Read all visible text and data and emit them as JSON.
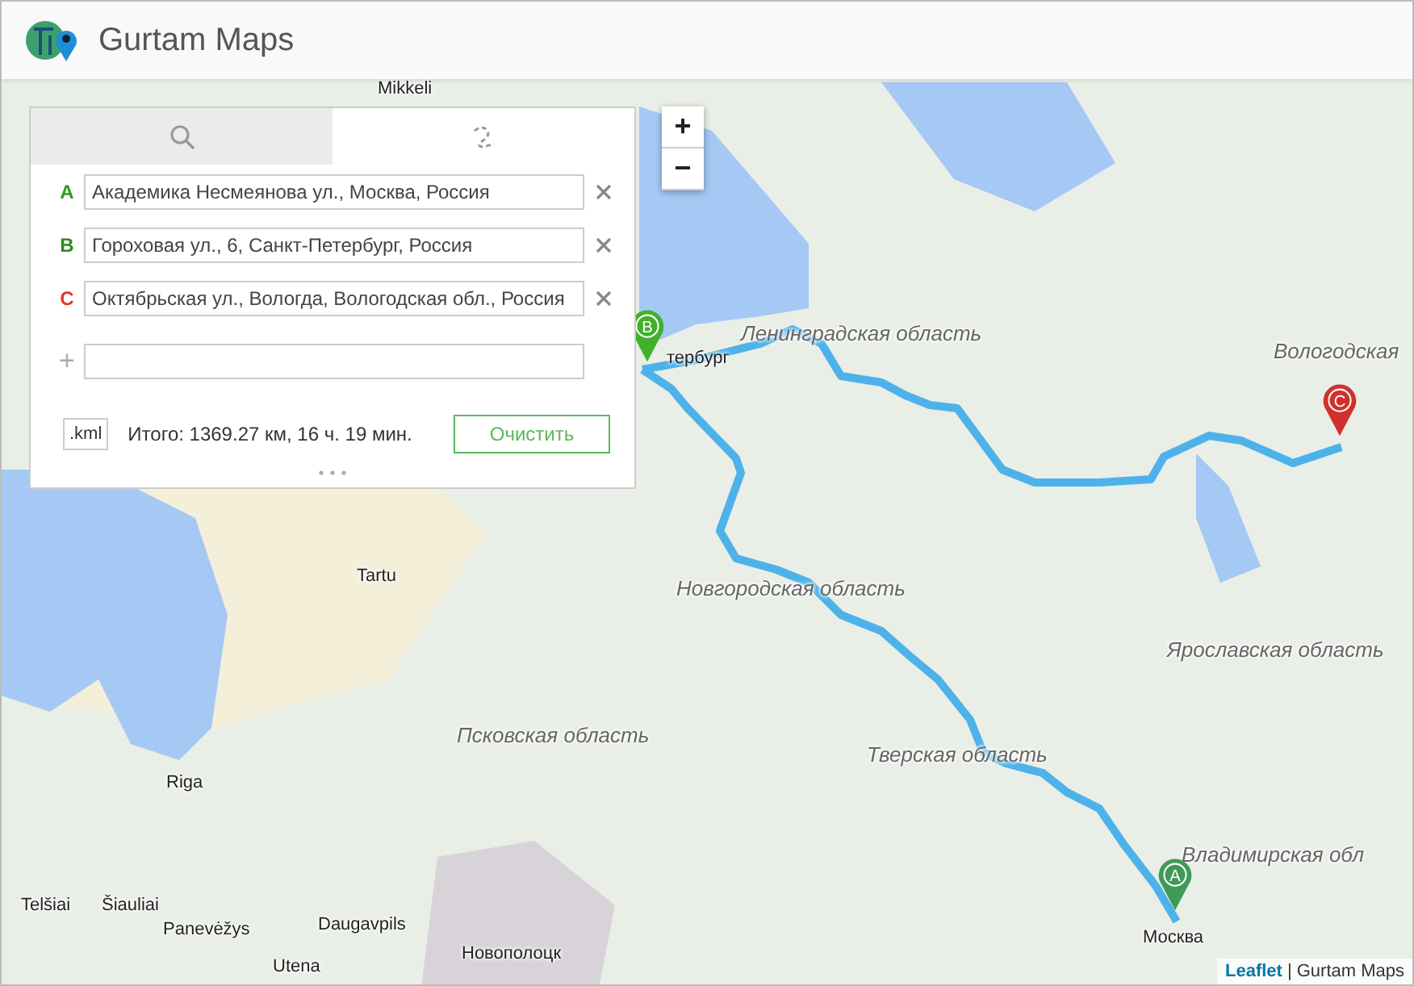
{
  "header": {
    "title": "Gurtam Maps"
  },
  "panel": {
    "tabs": [
      {
        "kind": "search",
        "selected": false
      },
      {
        "kind": "route",
        "selected": true
      }
    ],
    "waypoints": [
      {
        "letter": "A",
        "color": "#2e9a1e",
        "value": "Академика Несмеянова ул., Москва, Россия"
      },
      {
        "letter": "B",
        "color": "#2e8a1e",
        "value": "Гороховая ул., 6, Санкт-Петербург, Россия"
      },
      {
        "letter": "C",
        "color": "#e8332a",
        "value": "Октябрьская ул., Вологда, Вологодская обл., Россия"
      }
    ],
    "add_symbol": "+",
    "export_button": ".kml",
    "total": "Итого: 1369.27 км, 16 ч. 19 мин.",
    "clear_button": "Очистить"
  },
  "zoom": {
    "in": "+",
    "out": "−"
  },
  "map_labels": [
    {
      "text": "Mikkeli",
      "kind": "city"
    },
    {
      "text": "Ленинградская область",
      "kind": "region"
    },
    {
      "text": "Вологодская",
      "kind": "region"
    },
    {
      "text": "тербург",
      "kind": "city"
    },
    {
      "text": "Tartu",
      "kind": "city"
    },
    {
      "text": "Новгородская область",
      "kind": "region"
    },
    {
      "text": "Ярославская область",
      "kind": "region"
    },
    {
      "text": "Псковская область",
      "kind": "region"
    },
    {
      "text": "Тверская область",
      "kind": "region"
    },
    {
      "text": "Riga",
      "kind": "city"
    },
    {
      "text": "Владимирская обл",
      "kind": "region"
    },
    {
      "text": "Telšiai",
      "kind": "city"
    },
    {
      "text": "Šiauliai",
      "kind": "city"
    },
    {
      "text": "Panevėžys",
      "kind": "city"
    },
    {
      "text": "Daugavpils",
      "kind": "city"
    },
    {
      "text": "Utena",
      "kind": "city"
    },
    {
      "text": "Новополоцк",
      "kind": "city"
    },
    {
      "text": "Москва",
      "kind": "city"
    }
  ],
  "markers": [
    {
      "letter": "A",
      "color": "#3f9a5a"
    },
    {
      "letter": "B",
      "color": "#43b02a"
    },
    {
      "letter": "C",
      "color": "#d0312d"
    }
  ],
  "attribution": {
    "link": "Leaflet",
    "text": "| Gurtam Maps"
  }
}
